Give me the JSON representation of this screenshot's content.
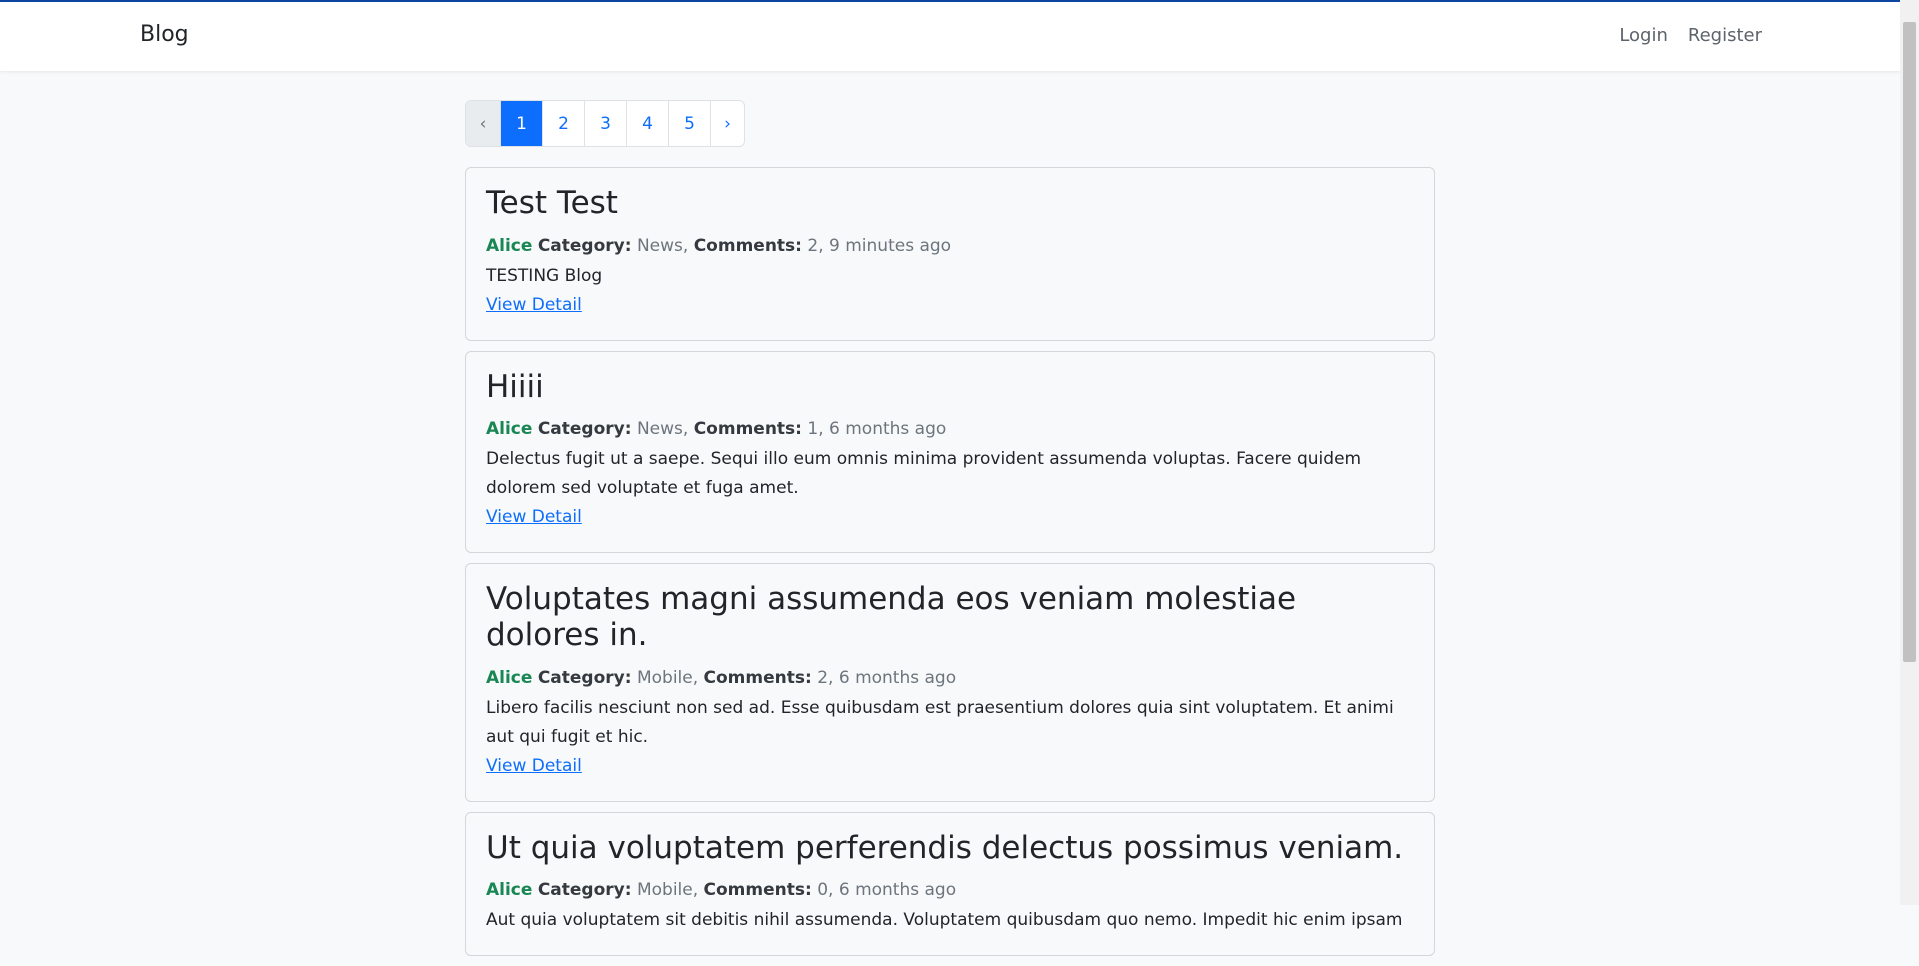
{
  "navbar": {
    "brand": "Blog",
    "login": "Login",
    "register": "Register"
  },
  "pagination": {
    "prev": "‹",
    "pages": [
      "1",
      "2",
      "3",
      "4",
      "5"
    ],
    "active_page": "1",
    "next": "›"
  },
  "labels": {
    "category": "Category:",
    "comments": "Comments:",
    "view_detail": "View Detail"
  },
  "posts": [
    {
      "title": "Test Test",
      "author": "Alice",
      "category": "News,",
      "comments": "2,",
      "time": "9 minutes ago",
      "body": "TESTING Blog"
    },
    {
      "title": "Hiiii",
      "author": "Alice",
      "category": "News,",
      "comments": "1,",
      "time": "6 months ago",
      "body": "Delectus fugit ut a saepe. Sequi illo eum omnis minima provident assumenda voluptas. Facere quidem dolorem sed voluptate et fuga amet."
    },
    {
      "title": "Voluptates magni assumenda eos veniam molestiae dolores in.",
      "author": "Alice",
      "category": "Mobile,",
      "comments": "2,",
      "time": "6 months ago",
      "body": "Libero facilis nesciunt non sed ad. Esse quibusdam est praesentium dolores quia sint voluptatem. Et animi aut qui fugit et hic."
    },
    {
      "title": "Ut quia voluptatem perferendis delectus possimus veniam.",
      "author": "Alice",
      "category": "Mobile,",
      "comments": "0,",
      "time": "6 months ago",
      "body": "Aut quia voluptatem sit debitis nihil assumenda. Voluptatem quibusdam quo nemo. Impedit hic enim ipsam"
    }
  ],
  "colors": {
    "accent": "#0d6efd",
    "author": "#198754",
    "background": "#f8f9fa"
  }
}
